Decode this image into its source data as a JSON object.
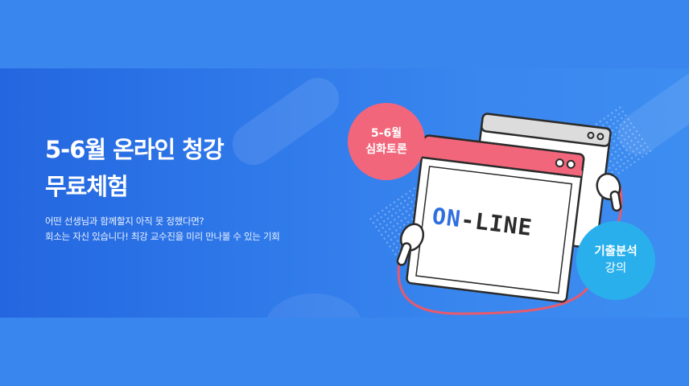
{
  "headline": {
    "line1": "5-6월 온라인 청강",
    "line2": "무료체험"
  },
  "description": {
    "line1": "어떤 선생님과 함께할지 아직 못 정했다면?",
    "line2": "회소는 자신 있습니다! 최강 교수진을 미리 만나볼 수 있는 기회"
  },
  "badge_pink": {
    "line1": "5-6월",
    "line2": "심화토론"
  },
  "badge_cyan": {
    "line1": "기출분석",
    "line2": "강의"
  },
  "illustration": {
    "screen_text": "ON-LINE"
  },
  "colors": {
    "background": "#3a86ef",
    "banner_left": "#2466df",
    "pink": "#f2667b",
    "cyan": "#29b0ec",
    "online_blue": "#2f6fe0"
  }
}
